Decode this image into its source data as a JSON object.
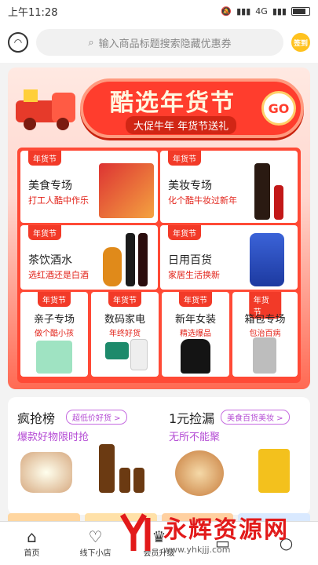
{
  "status": {
    "time": "上午11:28",
    "network": "4G"
  },
  "search": {
    "placeholder": "输入商品标题搜索隐藏优惠券",
    "sign_label": "签到"
  },
  "banner": {
    "title": "酷选年货节",
    "subtitle": "大促牛年 年货节送礼",
    "go_label": "GO"
  },
  "cards_top": [
    {
      "tag": "年货节",
      "title": "美食专场",
      "sub": "打工人酷中作乐"
    },
    {
      "tag": "年货节",
      "title": "美妆专场",
      "sub": "化个酷牛妆过新年"
    },
    {
      "tag": "年货节",
      "title": "茶饮酒水",
      "sub": "选红酒还是白酒"
    },
    {
      "tag": "年货节",
      "title": "日用百货",
      "sub": "家居生活换新"
    }
  ],
  "cards_bottom": [
    {
      "tag": "年货节",
      "title": "亲子专场",
      "sub": "做个酷小孩"
    },
    {
      "tag": "年货节",
      "title": "数码家电",
      "sub": "年终好货"
    },
    {
      "tag": "年货节",
      "title": "新年女装",
      "sub": "精选爆品"
    },
    {
      "tag": "年货节",
      "title": "箱包专场",
      "sub": "包治百病"
    }
  ],
  "lower": {
    "left": {
      "title": "疯抢榜",
      "badge": "超低价好货 >",
      "sub": "爆款好物限时抢"
    },
    "right": {
      "title": "1元捡漏",
      "badge": "美食百货美妆 >",
      "sub": "无所不能聚"
    }
  },
  "tabs": [
    {
      "label": "首页",
      "icon": "home-icon"
    },
    {
      "label": "线下小店",
      "icon": "store-icon"
    },
    {
      "label": "会员升级",
      "icon": "member-icon"
    },
    {
      "label": "",
      "icon": "cart-icon"
    },
    {
      "label": "",
      "icon": "user-icon"
    }
  ],
  "watermark": {
    "text": "永辉资源网",
    "url": "www.yhkjjj.com"
  },
  "colors": {
    "accent": "#f23a28",
    "purple": "#b44bd4",
    "banner_red": "#ff3d2d"
  }
}
